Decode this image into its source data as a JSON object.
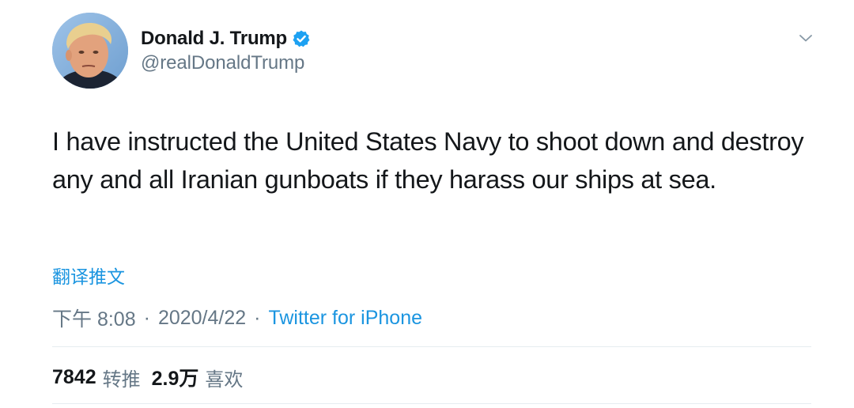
{
  "author": {
    "display_name": "Donald J. Trump",
    "handle": "@realDonaldTrump",
    "verified": true,
    "verified_color": "#1da1f2"
  },
  "tweet": {
    "text": "I have instructed the United States Navy to shoot down and destroy any and all Iranian gunboats if they harass our ships at sea.",
    "translate_label": "翻译推文",
    "time": "下午 8:08",
    "separator": "·",
    "date": "2020/4/22",
    "source": "Twitter for iPhone"
  },
  "stats": {
    "retweets": {
      "count": "7842",
      "label": "转推"
    },
    "likes": {
      "count": "2.9万",
      "label": "喜欢"
    }
  },
  "colors": {
    "link": "#1b95e0",
    "secondary_text": "#657786",
    "primary_text": "#14171a",
    "divider": "#e6ecf0"
  },
  "icons": {
    "verified": "verified-badge-icon",
    "menu": "chevron-down-icon"
  }
}
